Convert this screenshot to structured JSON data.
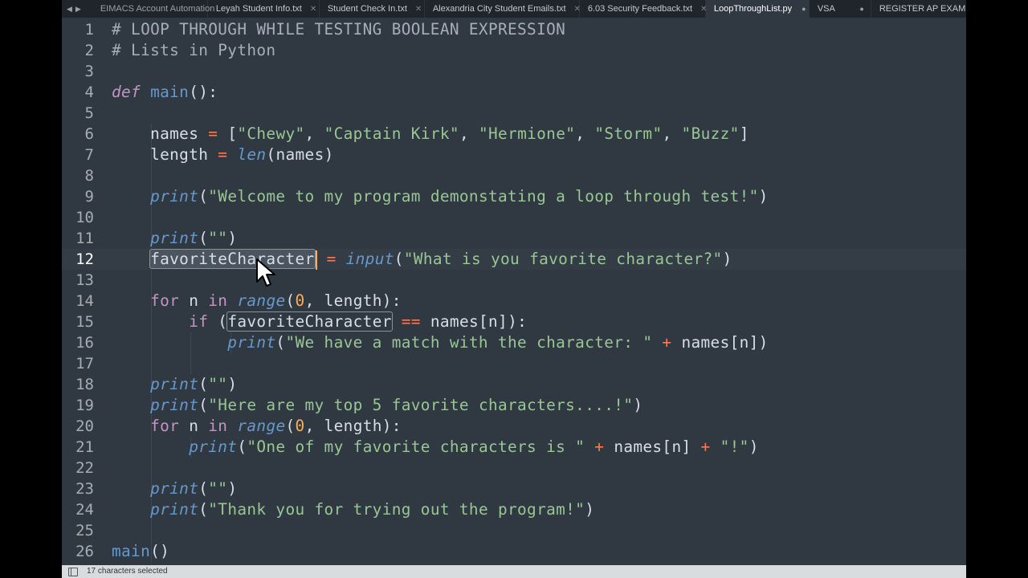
{
  "tabs": [
    {
      "label": "EIMACS Account Automation",
      "active": false
    },
    {
      "label": "Leyah Student Info.txt",
      "active": false
    },
    {
      "label": "Student Check In.txt",
      "active": false
    },
    {
      "label": "Alexandria City Student Emails.txt",
      "active": false
    },
    {
      "label": "6.03 Security Feedback.txt",
      "active": false
    },
    {
      "label": "LoopThroughList.py",
      "active": true
    },
    {
      "label": "VSA",
      "active": false
    },
    {
      "label": "REGISTER AP EXAM REM",
      "active": false
    }
  ],
  "nav": {
    "back": "◀",
    "forward": "▶"
  },
  "code_lines": [
    {
      "n": "1"
    },
    {
      "n": "2"
    },
    {
      "n": "3"
    },
    {
      "n": "4"
    },
    {
      "n": "5"
    },
    {
      "n": "6"
    },
    {
      "n": "7"
    },
    {
      "n": "8"
    },
    {
      "n": "9"
    },
    {
      "n": "10"
    },
    {
      "n": "11"
    },
    {
      "n": "12"
    },
    {
      "n": "13"
    },
    {
      "n": "14"
    },
    {
      "n": "15"
    },
    {
      "n": "16"
    },
    {
      "n": "17"
    },
    {
      "n": "18"
    },
    {
      "n": "19"
    },
    {
      "n": "20"
    },
    {
      "n": "21"
    },
    {
      "n": "22"
    },
    {
      "n": "23"
    },
    {
      "n": "24"
    },
    {
      "n": "25"
    },
    {
      "n": "26"
    }
  ],
  "code": {
    "l1": "# LOOP THROUGH WHILE TESTING BOOLEAN EXPRESSION",
    "l2": "# Lists in Python",
    "def": "def",
    "main_name": "main",
    "paren_colon": "():",
    "names_var": "names",
    "eq": "=",
    "lb": "[",
    "s_chewy": "\"Chewy\"",
    "comma": ",",
    "s_kirk": "\"Captain Kirk\"",
    "s_hermione": "\"Hermione\"",
    "s_storm": "\"Storm\"",
    "s_buzz": "\"Buzz\"",
    "rb": "]",
    "length_var": "length",
    "len_fn": "len",
    "lp": "(",
    "rp": ")",
    "print_fn": "print",
    "s_welcome": "\"Welcome to my program demonstating a loop through test!\"",
    "s_empty": "\"\"",
    "fav_var": "favoriteCharacter",
    "input_fn": "input",
    "s_question": "\"What is you favorite character?\"",
    "for_kw": "for",
    "n_var": "n",
    "in_kw": "in",
    "range_fn": "range",
    "zero": "0",
    "close_colon": "):",
    "if_kw": "if",
    "eqeq": "==",
    "names_idx": "names[n]",
    "s_match": "\"We have a match with the character: \"",
    "plus": "+",
    "s_top5": "\"Here are my top 5 favorite characters....!\"",
    "s_oneof": "\"One of my favorite characters is \"",
    "s_bang": "\"!\"",
    "s_thanks": "\"Thank you for trying out the program!\"",
    "main_call": "main",
    "call_parens": "()"
  },
  "status": {
    "message": "17 characters selected"
  },
  "colors": {
    "background": "#303841",
    "keyword": "#c594c5",
    "string": "#99c794",
    "function": "#6699cc",
    "operator": "#f97b58",
    "number": "#f9ae58"
  }
}
